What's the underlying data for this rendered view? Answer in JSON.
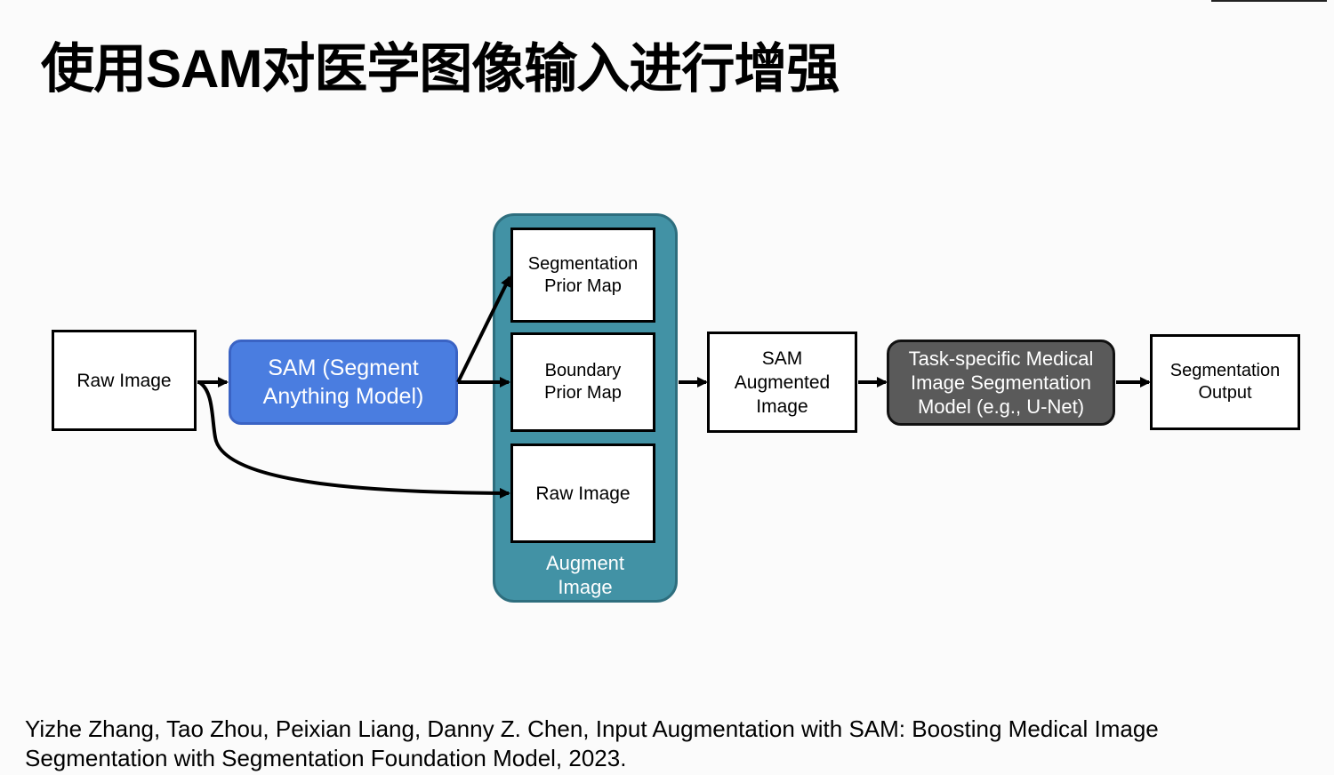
{
  "slide": {
    "title": "使用SAM对医学图像输入进行增强",
    "citation": "Yizhe Zhang, Tao Zhou, Peixian Liang, Danny Z. Chen, Input Augmentation with SAM: Boosting Medical Image\nSegmentation with Segmentation Foundation Model, 2023."
  },
  "diagram": {
    "raw_image_input": "Raw Image",
    "sam_model": "SAM (Segment\nAnything Model)",
    "augment_group": {
      "label": "Augment\nImage",
      "segmentation_prior_map": "Segmentation\nPrior Map",
      "boundary_prior_map": "Boundary\nPrior Map",
      "raw_image": "Raw Image"
    },
    "sam_augmented_image": "SAM\nAugmented\nImage",
    "task_model": "Task-specific Medical\nImage Segmentation\nModel (e.g., U-Net)",
    "segmentation_output": "Segmentation\nOutput"
  },
  "colors": {
    "sam_blue": "#4a7de0",
    "augment_teal": "#4292a5",
    "task_gray": "#5a5a5a"
  }
}
